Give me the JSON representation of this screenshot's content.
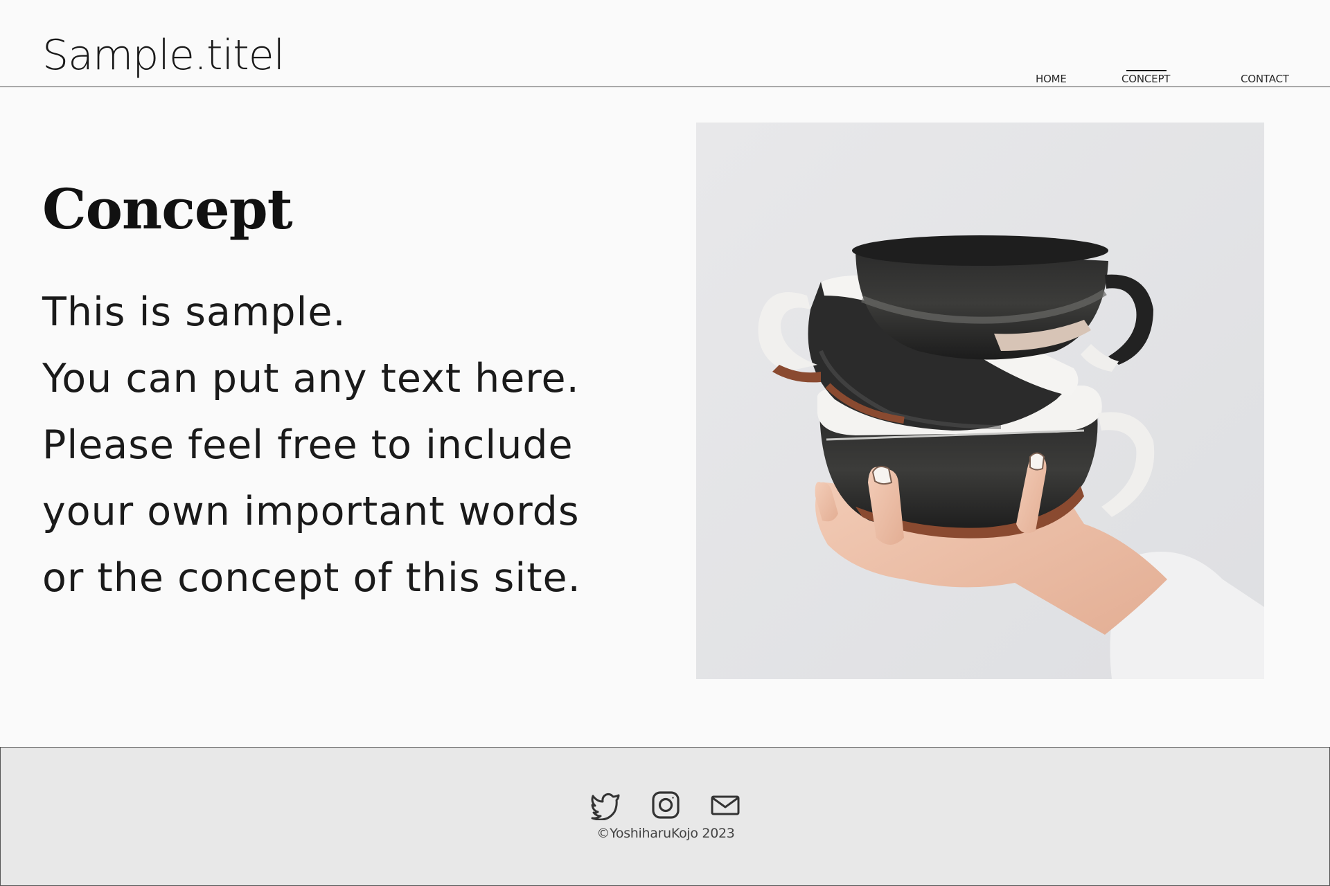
{
  "header": {
    "site_title": "Sample.titel",
    "nav": [
      {
        "label": "HOME",
        "active": false
      },
      {
        "label": "CONCEPT",
        "active": true
      },
      {
        "label": "CONTACT",
        "active": false
      }
    ]
  },
  "main": {
    "heading": "Concept",
    "body_lines": [
      "This is sample.",
      "You can put any text here.",
      "Please feel free to include",
      "your own important words",
      "or the concept of this site."
    ],
    "photo_icon": "stacked-ceramic-cups-photo"
  },
  "footer": {
    "social": [
      {
        "icon": "twitter-icon"
      },
      {
        "icon": "instagram-icon"
      },
      {
        "icon": "mail-icon"
      }
    ],
    "copyright": "©YoshiharuKojo 2023"
  },
  "colors": {
    "background": "#fafafa",
    "text": "#1a1a1a",
    "footer_bg": "#e8e8e8",
    "photo_bg": "#e6e6e8"
  }
}
